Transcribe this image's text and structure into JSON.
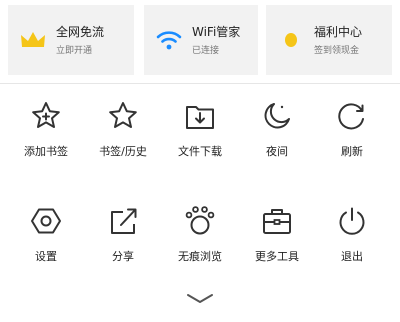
{
  "cards": [
    {
      "title": "全网免流",
      "subtitle": "立即开通",
      "icon": "crown-icon",
      "icon_color": "#f5c518"
    },
    {
      "title": "WiFi管家",
      "subtitle": "已连接",
      "icon": "wifi-icon",
      "icon_color": "#1a8cff"
    },
    {
      "title": "福利中心",
      "subtitle": "签到领现金",
      "icon": "coin-icon",
      "icon_color": "#f5c518"
    }
  ],
  "menu_row1": [
    {
      "label": "添加书签",
      "icon": "star-plus-icon"
    },
    {
      "label": "书签/历史",
      "icon": "star-icon"
    },
    {
      "label": "文件下载",
      "icon": "folder-download-icon"
    },
    {
      "label": "夜间",
      "icon": "moon-icon"
    },
    {
      "label": "刷新",
      "icon": "refresh-icon"
    }
  ],
  "menu_row2": [
    {
      "label": "设置",
      "icon": "settings-icon"
    },
    {
      "label": "分享",
      "icon": "share-icon"
    },
    {
      "label": "无痕浏览",
      "icon": "paw-icon"
    },
    {
      "label": "更多工具",
      "icon": "toolbox-icon"
    },
    {
      "label": "退出",
      "icon": "power-icon"
    }
  ],
  "collapse": {
    "icon": "chevron-down-icon"
  }
}
